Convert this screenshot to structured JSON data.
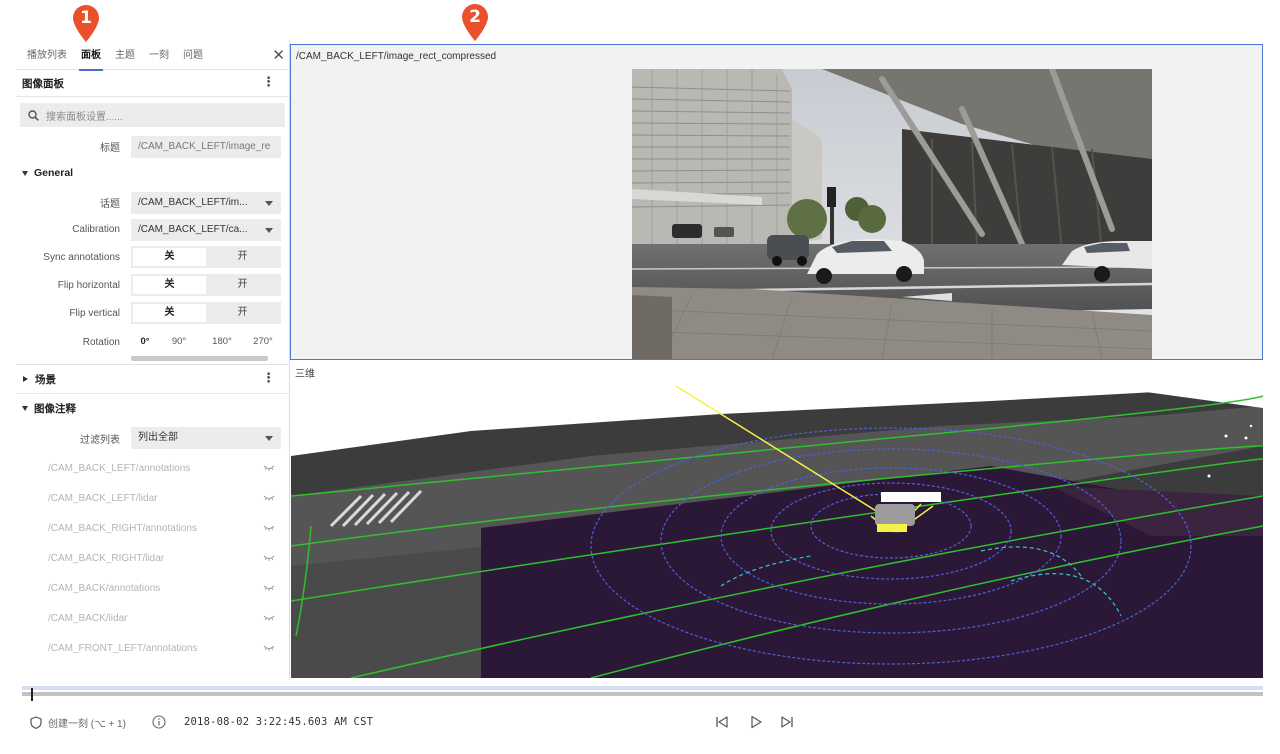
{
  "markers": {
    "first": "1",
    "second": "2"
  },
  "colors": {
    "marker": "#e8512c",
    "accent": "#4d6bcd",
    "active_border": "#4c77d4"
  },
  "sidebar": {
    "tabs": [
      {
        "label": "播放列表",
        "active": false
      },
      {
        "label": "面板",
        "active": true
      },
      {
        "label": "主题",
        "active": false
      },
      {
        "label": "一刻",
        "active": false
      },
      {
        "label": "问题",
        "active": false
      }
    ],
    "panel_title": "图像面板",
    "search_placeholder": "搜索面板设置......",
    "title_label": "标题",
    "title_value": "/CAM_BACK_LEFT/image_re",
    "general": {
      "label": "General",
      "topic_label": "话题",
      "topic_value": "/CAM_BACK_LEFT/im...",
      "calibration_label": "Calibration",
      "calibration_value": "/CAM_BACK_LEFT/ca...",
      "sync_label": "Sync annotations",
      "fliph_label": "Flip horizontal",
      "flipv_label": "Flip vertical",
      "off": "关",
      "on": "开",
      "rotation_label": "Rotation",
      "rotation_options": [
        "0°",
        "90°",
        "180°",
        "270°"
      ]
    },
    "scene_label": "场景",
    "annotations": {
      "label": "图像注释",
      "filter_label": "过滤列表",
      "filter_value": "列出全部",
      "items": [
        "/CAM_BACK_LEFT/annotations",
        "/CAM_BACK_LEFT/lidar",
        "/CAM_BACK_RIGHT/annotations",
        "/CAM_BACK_RIGHT/lidar",
        "/CAM_BACK/annotations",
        "/CAM_BACK/lidar",
        "/CAM_FRONT_LEFT/annotations"
      ]
    }
  },
  "image_panel": {
    "title": "/CAM_BACK_LEFT/image_rect_compressed"
  },
  "scene_panel": {
    "title": "三维"
  },
  "playback": {
    "progress": 0.007,
    "create_moment": "创建一刻 (⌥ + 1)",
    "timestamp": "2018-08-02 3:22:45.603 AM CST"
  },
  "icons": [
    "shield-icon",
    "info-icon",
    "skip-back-icon",
    "play-icon",
    "skip-forward-icon",
    "search-icon",
    "eye-hidden-icon",
    "kebab-icon",
    "close-icon"
  ]
}
